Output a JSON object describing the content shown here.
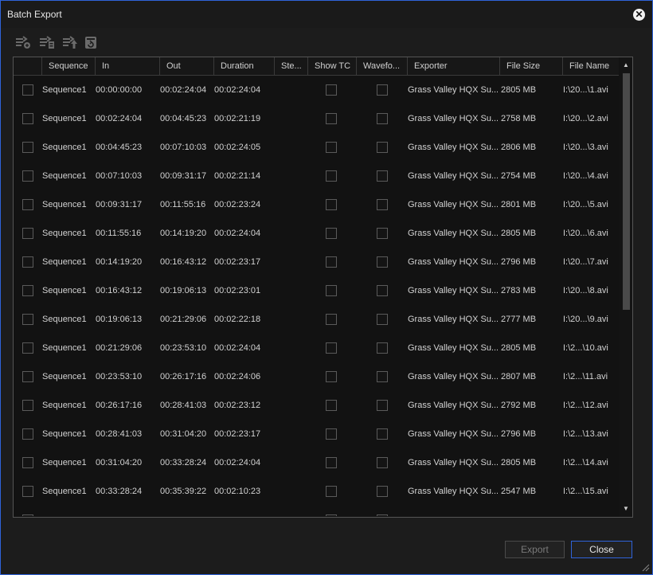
{
  "window": {
    "title": "Batch Export"
  },
  "toolbar": {
    "icons": [
      "add-queue-icon",
      "export-queue-icon",
      "move-up-icon",
      "clear-queue-icon"
    ]
  },
  "table": {
    "columns": [
      "Sequence",
      "In",
      "Out",
      "Duration",
      "Ste...",
      "Show TC",
      "Wavefo...",
      "Exporter",
      "File Size",
      "File Name"
    ],
    "rows": [
      [
        "Sequence1",
        "00:00:00:00",
        "00:02:24:04",
        "00:02:24:04",
        "Grass Valley HQX Su...",
        "2805 MB",
        "I:\\20...\\1.avi"
      ],
      [
        "Sequence1",
        "00:02:24:04",
        "00:04:45:23",
        "00:02:21:19",
        "Grass Valley HQX Su...",
        "2758 MB",
        "I:\\20...\\2.avi"
      ],
      [
        "Sequence1",
        "00:04:45:23",
        "00:07:10:03",
        "00:02:24:05",
        "Grass Valley HQX Su...",
        "2806 MB",
        "I:\\20...\\3.avi"
      ],
      [
        "Sequence1",
        "00:07:10:03",
        "00:09:31:17",
        "00:02:21:14",
        "Grass Valley HQX Su...",
        "2754 MB",
        "I:\\20...\\4.avi"
      ],
      [
        "Sequence1",
        "00:09:31:17",
        "00:11:55:16",
        "00:02:23:24",
        "Grass Valley HQX Su...",
        "2801 MB",
        "I:\\20...\\5.avi"
      ],
      [
        "Sequence1",
        "00:11:55:16",
        "00:14:19:20",
        "00:02:24:04",
        "Grass Valley HQX Su...",
        "2805 MB",
        "I:\\20...\\6.avi"
      ],
      [
        "Sequence1",
        "00:14:19:20",
        "00:16:43:12",
        "00:02:23:17",
        "Grass Valley HQX Su...",
        "2796 MB",
        "I:\\20...\\7.avi"
      ],
      [
        "Sequence1",
        "00:16:43:12",
        "00:19:06:13",
        "00:02:23:01",
        "Grass Valley HQX Su...",
        "2783 MB",
        "I:\\20...\\8.avi"
      ],
      [
        "Sequence1",
        "00:19:06:13",
        "00:21:29:06",
        "00:02:22:18",
        "Grass Valley HQX Su...",
        "2777 MB",
        "I:\\20...\\9.avi"
      ],
      [
        "Sequence1",
        "00:21:29:06",
        "00:23:53:10",
        "00:02:24:04",
        "Grass Valley HQX Su...",
        "2805 MB",
        "I:\\2...\\10.avi"
      ],
      [
        "Sequence1",
        "00:23:53:10",
        "00:26:17:16",
        "00:02:24:06",
        "Grass Valley HQX Su...",
        "2807 MB",
        "I:\\2...\\11.avi"
      ],
      [
        "Sequence1",
        "00:26:17:16",
        "00:28:41:03",
        "00:02:23:12",
        "Grass Valley HQX Su...",
        "2792 MB",
        "I:\\2...\\12.avi"
      ],
      [
        "Sequence1",
        "00:28:41:03",
        "00:31:04:20",
        "00:02:23:17",
        "Grass Valley HQX Su...",
        "2796 MB",
        "I:\\2...\\13.avi"
      ],
      [
        "Sequence1",
        "00:31:04:20",
        "00:33:28:24",
        "00:02:24:04",
        "Grass Valley HQX Su...",
        "2805 MB",
        "I:\\2...\\14.avi"
      ],
      [
        "Sequence1",
        "00:33:28:24",
        "00:35:39:22",
        "00:02:10:23",
        "Grass Valley HQX Su...",
        "2547 MB",
        "I:\\2...\\15.avi"
      ]
    ]
  },
  "footer": {
    "export_label": "Export",
    "close_label": "Close"
  },
  "colors": {
    "accent": "#2f63d9",
    "background": "#1c1c1c",
    "table_bg": "#121212"
  }
}
